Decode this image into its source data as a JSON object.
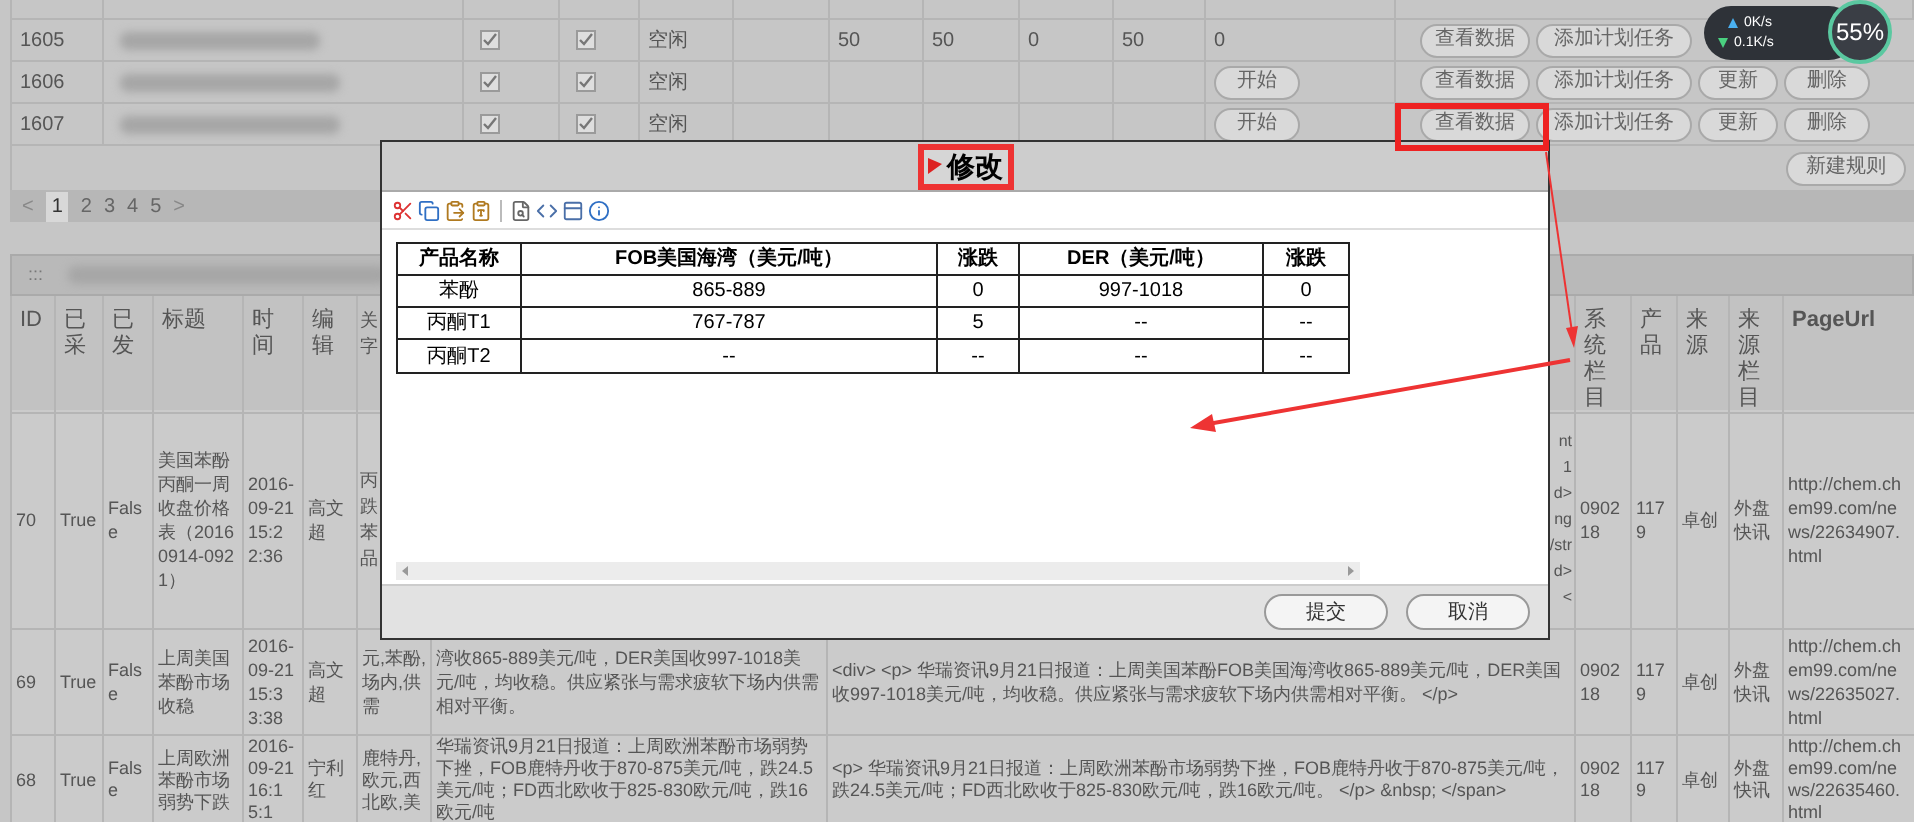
{
  "top_table": {
    "rows": [
      {
        "id": "1605",
        "flag_a": true,
        "flag_b": true,
        "status": "空闲",
        "column_7": "50",
        "column_8": "50",
        "column_9": "0",
        "column_10": "50",
        "column_11": "0",
        "actions": [
          "查看数据",
          "添加计划任务"
        ]
      },
      {
        "id": "1606",
        "flag_a": true,
        "flag_b": true,
        "status": "空闲",
        "start": "开始",
        "actions": [
          "查看数据",
          "添加计划任务",
          "更新",
          "删除"
        ]
      },
      {
        "id": "1607",
        "flag_a": true,
        "flag_b": true,
        "status": "空闲",
        "start": "开始",
        "actions": [
          "查看数据",
          "添加计划任务",
          "更新",
          "删除"
        ]
      }
    ]
  },
  "new_rule_button": "新建规则",
  "pager": {
    "prev": "<",
    "next": ">",
    "pages": [
      {
        "label": "1",
        "selected": true
      },
      {
        "label": "2",
        "selected": false
      },
      {
        "label": "3",
        "selected": false
      },
      {
        "label": "4",
        "selected": false
      },
      {
        "label": "5",
        "selected": false
      }
    ]
  },
  "panel": {
    "handle": ":::"
  },
  "table": {
    "columns": {
      "id": "ID",
      "collected": "已采",
      "published": "已发",
      "title": "标题",
      "time": "时间",
      "editor": "编辑",
      "keywords": [
        "关",
        "字"
      ],
      "category": "系统栏目",
      "product": "产品",
      "source": "来源",
      "source_category": "来源栏目",
      "page_url": "PageUrl"
    },
    "rows": [
      {
        "id": "70",
        "collected": "True",
        "published": "False",
        "title": "美国苯酚丙酮一周收盘价格表（20160914-0921）",
        "time": "2016-09-21 15:22:36",
        "editor": "高文超",
        "keywords": [
          "丙",
          "跌",
          "苯",
          "品"
        ],
        "content": [
          "nt",
          "1",
          "d>",
          "ng",
          "/str",
          "d>",
          "<"
        ],
        "category": "090218",
        "product": "1179",
        "source": "卓创",
        "source_category": "外盘快讯",
        "page_url": "http://chem.chem99.com/news/22634907.html"
      },
      {
        "id": "69",
        "collected": "True",
        "published": "False",
        "title": "上周美国苯酚市场收稳",
        "time": "2016-09-21 15:33:38",
        "editor": "高文超",
        "keywords": "元,苯酚,场内,供需",
        "summary": "湾收865-889美元/吨，DER美国收997-1018美元/吨，均收稳。供应紧张与需求疲软下场内供需相对平衡。",
        "content": "<div> <p>  华瑞资讯9月21日报道：上周美国苯酚FOB美国海湾收865-889美元/吨，DER美国收997-1018美元/吨，均收稳。供应紧张与需求疲软下场内供需相对平衡。 </p>",
        "category": "090218",
        "product": "1179",
        "source": "卓创",
        "source_category": "外盘快讯",
        "page_url": "http://chem.chem99.com/news/22635027.html"
      },
      {
        "id": "68",
        "collected": "True",
        "published": "False",
        "title": "上周欧洲苯酚市场弱势下跌",
        "time": "2016-09-21 16:15:1",
        "editor": "宁利红",
        "keywords": "鹿特丹,欧元,西北欧,美",
        "summary": "华瑞资讯9月21日报道：上周欧洲苯酚市场弱势下挫，FOB鹿特丹收于870-875美元/吨，跌24.5美元/吨；FD西北欧收于825-830欧元/吨，跌16欧元/吨",
        "content": "<p>  华瑞资讯9月21日报道：上周欧洲苯酚市场弱势下挫，FOB鹿特丹收于870-875美元/吨，跌24.5美元/吨；FD西北欧收于825-830欧元/吨，跌16欧元/吨。 </p> &nbsp; </span>",
        "category": "090218",
        "product": "1179",
        "source": "卓创",
        "source_category": "外盘快讯",
        "page_url": "http://chem.chem99.com/news/22635460.html"
      }
    ]
  },
  "dialog": {
    "title": "修改",
    "table": {
      "columns": [
        "产品名称",
        "FOB美国海湾（美元/吨）",
        "涨跌",
        "DER（美元/吨）",
        "涨跌"
      ],
      "rows": [
        [
          "苯酚",
          "865-889",
          "0",
          "997-1018",
          "0"
        ],
        [
          "丙酮T1",
          "767-787",
          "5",
          "--",
          "--"
        ],
        [
          "丙酮T2",
          "--",
          "--",
          "--",
          "--"
        ]
      ]
    },
    "buttons": [
      "提交",
      "取消"
    ]
  },
  "widget": {
    "upload": "0K/s",
    "download": "0.1K/s",
    "gauge": "55%"
  }
}
